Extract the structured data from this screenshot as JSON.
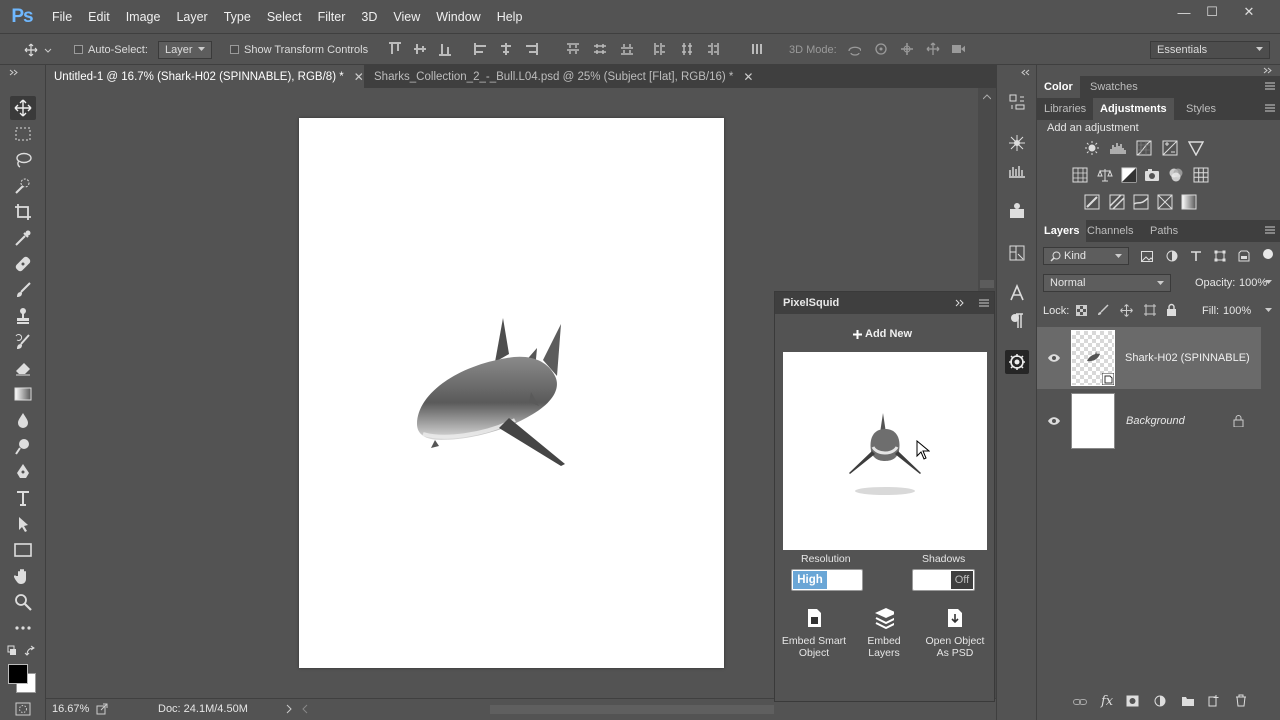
{
  "app": {
    "logo": "Ps"
  },
  "menu": [
    "File",
    "Edit",
    "Image",
    "Layer",
    "Type",
    "Select",
    "Filter",
    "3D",
    "View",
    "Window",
    "Help"
  ],
  "window_controls": {
    "minimize": "—",
    "maximize": "☐",
    "close": "✕"
  },
  "options_bar": {
    "auto_select_label": "Auto-Select:",
    "auto_select_value": "Layer",
    "transform_controls_label": "Show Transform Controls",
    "mode_3d_label": "3D Mode:",
    "workspace": "Essentials"
  },
  "tabs": [
    {
      "label": "Untitled-1 @ 16.7% (Shark-H02 (SPINNABLE), RGB/8) *",
      "active": true
    },
    {
      "label": "Sharks_Collection_2_-_Bull.L04.psd @ 25% (Subject [Flat], RGB/16) *",
      "active": false
    }
  ],
  "tab_close": "✕",
  "status": {
    "zoom": "16.67%",
    "doc": "Doc: 24.1M/4.50M"
  },
  "color_panel": {
    "tabs": [
      "Color",
      "Swatches"
    ]
  },
  "adjust_panel": {
    "tabs": [
      "Libraries",
      "Adjustments",
      "Styles"
    ],
    "active": "Adjustments",
    "heading": "Add an adjustment"
  },
  "layers_panel": {
    "tabs": [
      "Layers",
      "Channels",
      "Paths"
    ],
    "filter_kind": "Kind",
    "blend_mode": "Normal",
    "opacity_label": "Opacity:",
    "opacity_value": "100%",
    "lock_label": "Lock:",
    "fill_label": "Fill:",
    "fill_value": "100%",
    "layers": [
      {
        "name": "Shark-H02 (SPINNABLE)",
        "selected": true,
        "visible": true
      },
      {
        "name": "Background",
        "selected": false,
        "visible": true,
        "locked": true
      }
    ]
  },
  "pixelsquid": {
    "title": "PixelSquid",
    "add_new": "Add New",
    "resolution_label": "Resolution",
    "resolution_value": "High",
    "shadows_label": "Shadows",
    "shadows_value": "Off",
    "buttons": [
      {
        "label1": "Embed Smart",
        "label2": "Object"
      },
      {
        "label1": "Embed",
        "label2": "Layers"
      },
      {
        "label1": "Open Object",
        "label2": "As PSD"
      }
    ]
  },
  "colors": {
    "accent_toggle": "#6aa6d6",
    "ps_logo": "#6fb8ff"
  }
}
